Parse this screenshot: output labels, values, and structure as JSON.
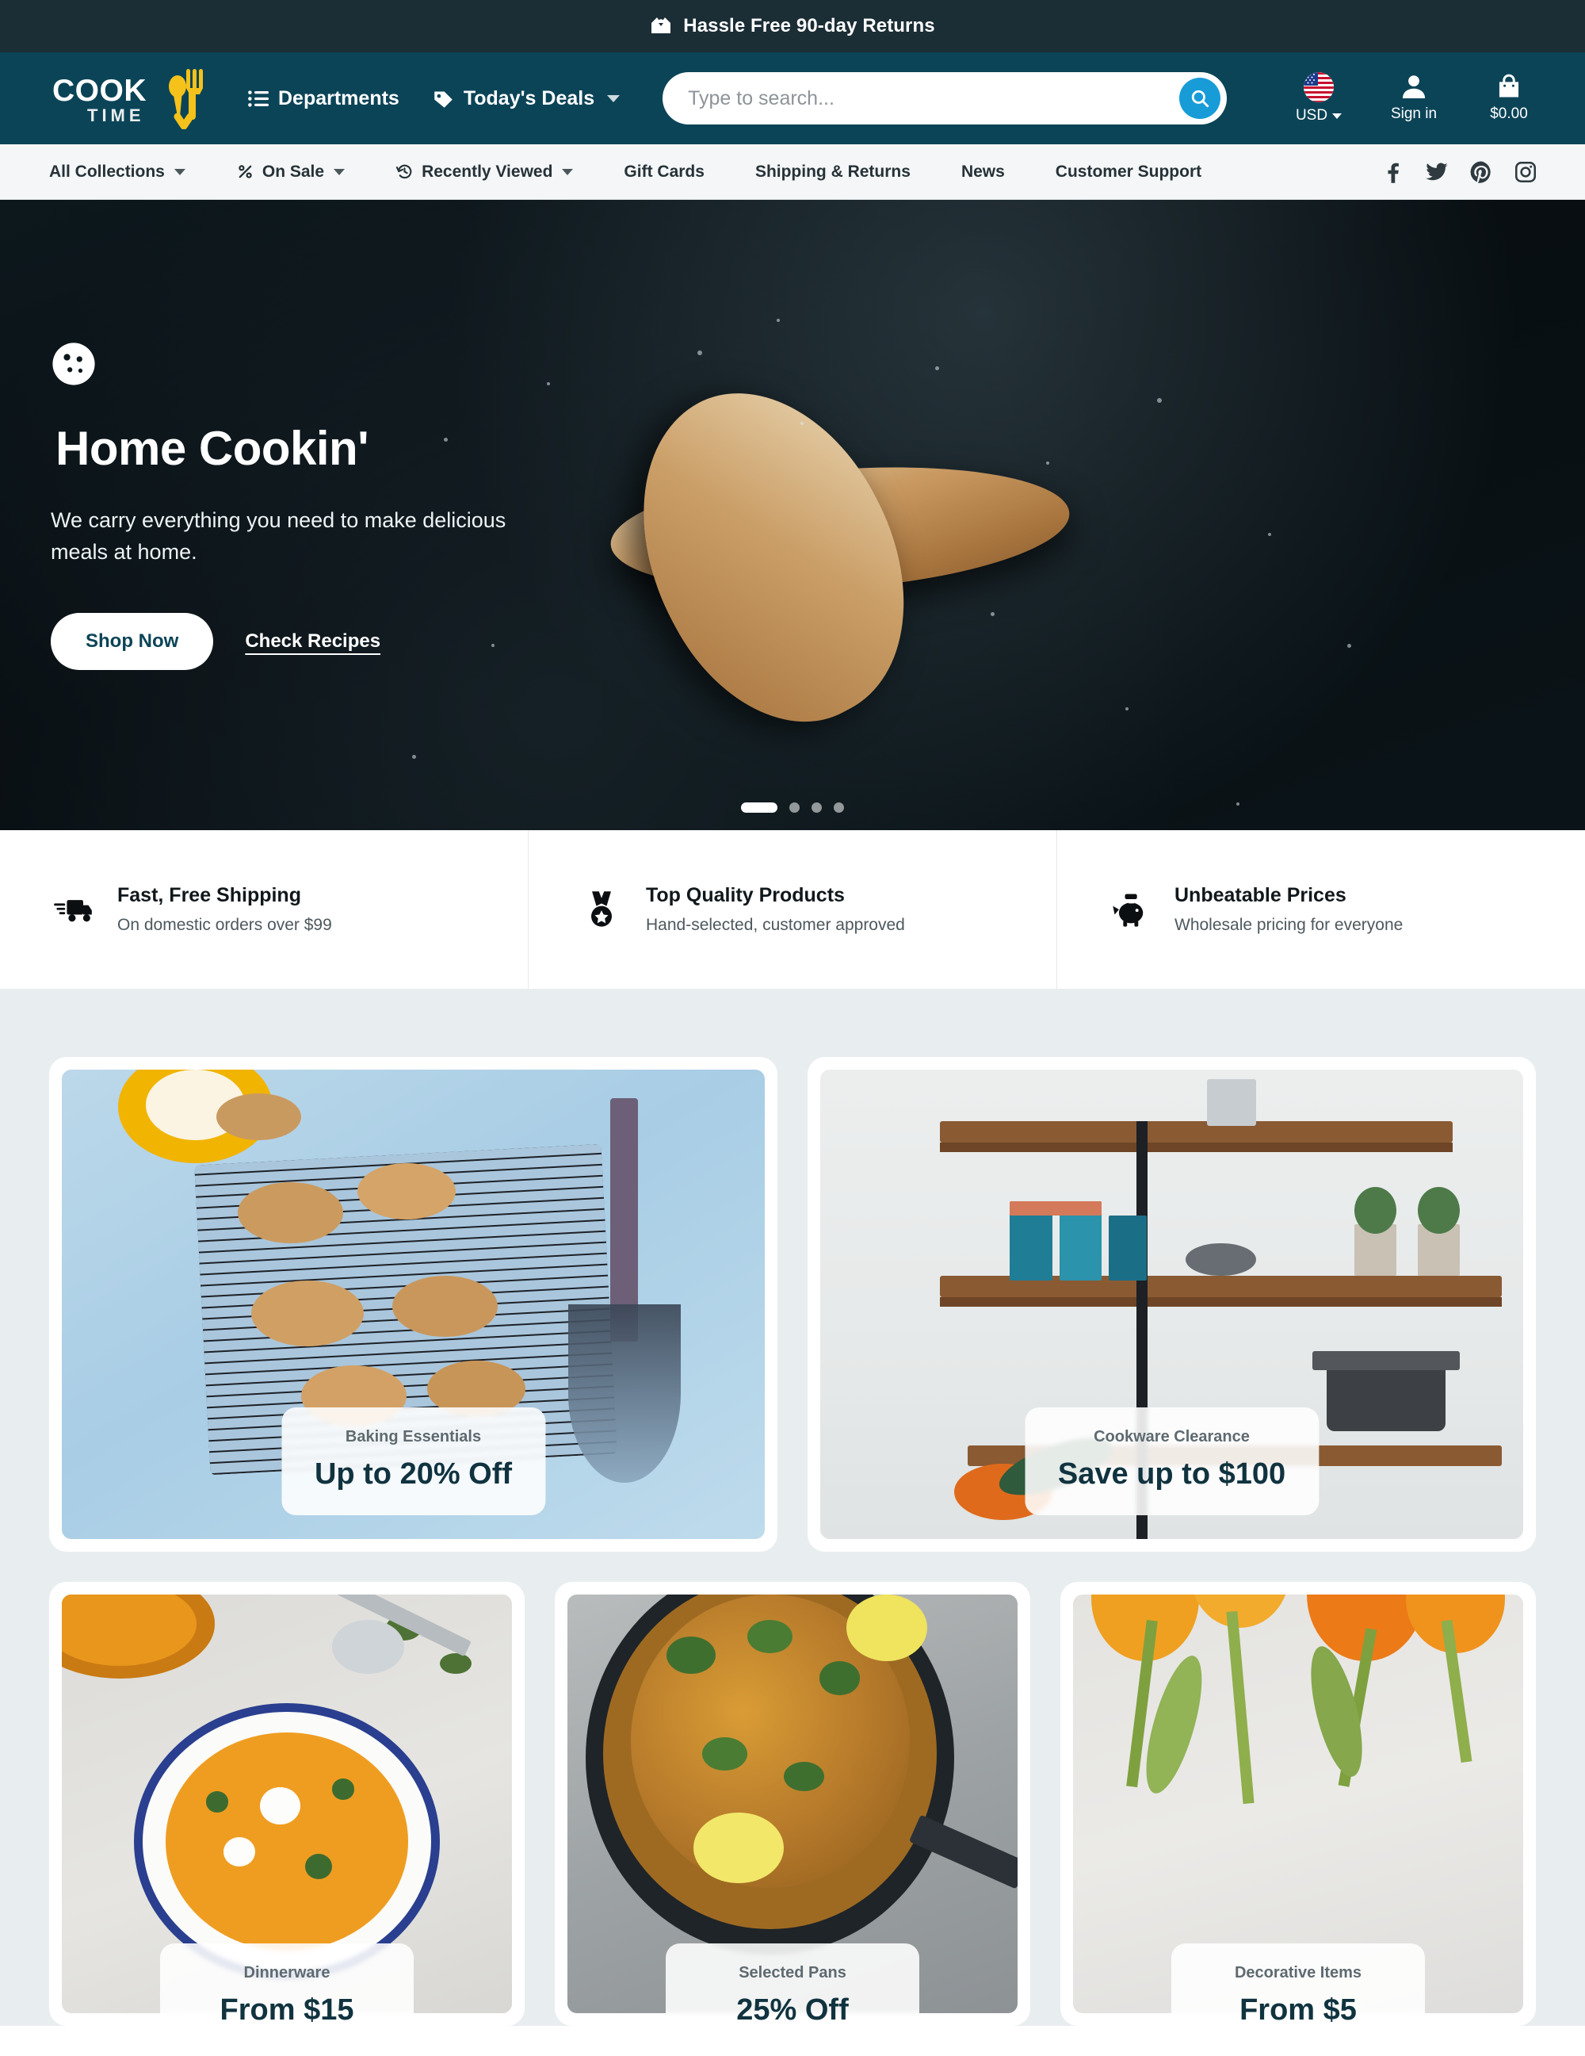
{
  "announcement": {
    "text": "Hassle Free 90-day Returns",
    "icon": "open-box-icon"
  },
  "header": {
    "logo": {
      "primary": "COOK",
      "secondary": "TIME"
    },
    "nav": [
      {
        "label": "Departments",
        "icon": "list-icon",
        "has_caret": false
      },
      {
        "label": "Today's Deals",
        "icon": "tag-icon",
        "has_caret": true
      }
    ],
    "search": {
      "placeholder": "Type to search...",
      "value": "",
      "icon": "search-icon"
    },
    "currency": {
      "label": "USD",
      "icon": "us-flag-icon"
    },
    "account": {
      "label": "Sign in",
      "icon": "user-icon"
    },
    "cart": {
      "label": "$0.00",
      "icon": "shopping-bag-icon"
    }
  },
  "subnav": {
    "items": [
      {
        "label": "All Collections",
        "icon": null,
        "has_caret": true
      },
      {
        "label": "On Sale",
        "icon": "percent-icon",
        "has_caret": true
      },
      {
        "label": "Recently Viewed",
        "icon": "history-icon",
        "has_caret": true
      },
      {
        "label": "Gift Cards",
        "icon": null,
        "has_caret": false
      },
      {
        "label": "Shipping & Returns",
        "icon": null,
        "has_caret": false
      },
      {
        "label": "News",
        "icon": null,
        "has_caret": false
      },
      {
        "label": "Customer Support",
        "icon": null,
        "has_caret": false
      }
    ],
    "socials": [
      "facebook-icon",
      "twitter-icon",
      "pinterest-icon",
      "instagram-icon"
    ]
  },
  "hero": {
    "badge_icon": "cookie-icon",
    "title": "Home Cookin'",
    "subtitle": "We carry everything you need to make delicious meals at home.",
    "primary_cta": "Shop Now",
    "secondary_cta": "Check Recipes",
    "slides_total": 4,
    "active_slide": 1,
    "highlight_color": "#b8960f"
  },
  "benefits": [
    {
      "icon": "delivery-truck-icon",
      "title": "Fast, Free Shipping",
      "subtitle": "On domestic orders over $99"
    },
    {
      "icon": "medal-icon",
      "title": "Top Quality Products",
      "subtitle": "Hand-selected, customer approved"
    },
    {
      "icon": "piggy-bank-icon",
      "title": "Unbeatable Prices",
      "subtitle": "Wholesale pricing for everyone"
    }
  ],
  "promos": {
    "row1": [
      {
        "kicker": "Baking Essentials",
        "deal": "Up to 20% Off",
        "scene": "cookies-on-rack"
      },
      {
        "kicker": "Cookware Clearance",
        "deal": "Save up to $100",
        "scene": "kitchen-shelf"
      }
    ],
    "row2": [
      {
        "kicker": "Dinnerware",
        "deal": "From $15",
        "scene": "pumpkin-soup-bowl"
      },
      {
        "kicker": "Selected Pans",
        "deal": "25% Off",
        "scene": "skillet-rice"
      },
      {
        "kicker": "Decorative Items",
        "deal": "From $5",
        "scene": "orange-tulips"
      }
    ]
  },
  "colors": {
    "announce_bg": "#1b2d35",
    "header_bg": "#0b4457",
    "subnav_bg": "#f4f6f7",
    "accent_blue": "#189cd8",
    "accent_yellow": "#f5c21b",
    "promo_bg": "#e8edf0",
    "deal_text": "#10333f"
  }
}
